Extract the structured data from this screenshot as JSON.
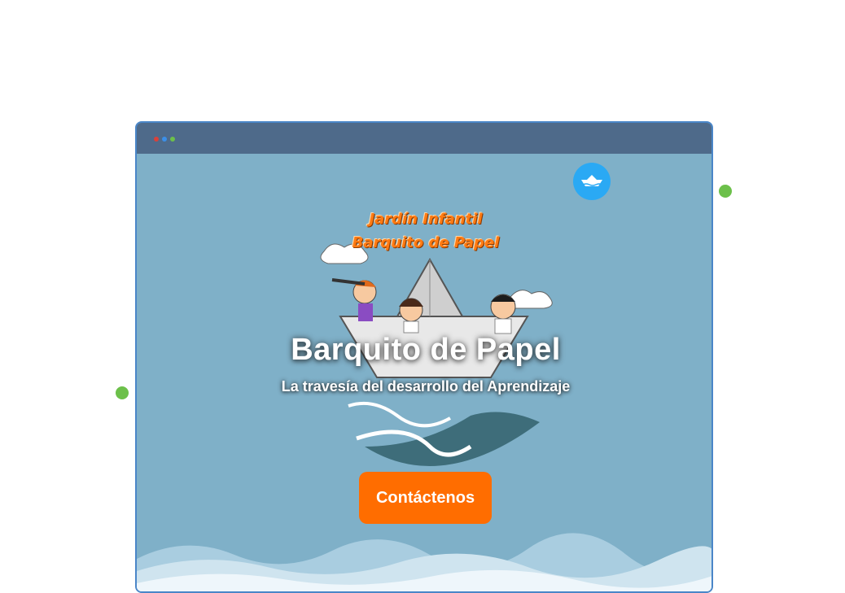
{
  "colors": {
    "page_background": "#ffffff",
    "window_border": "#4a86c8",
    "title_bar": "#4e6a8a",
    "hero_background": "#7fb0c8",
    "accent_orange": "#ff6d00",
    "badge_blue": "#2aa9f4",
    "decor_green": "#6cc04a",
    "window_dots": [
      "#d9413a",
      "#3b8fe8",
      "#6cc04a"
    ]
  },
  "window": {
    "controls": [
      "red-dot",
      "blue-dot",
      "green-dot"
    ]
  },
  "header": {
    "badge_icon": "paper-boat-icon"
  },
  "hero": {
    "logo_line_1": "Jardín Infantil",
    "logo_line_2": "Barquito de Papel",
    "title": "Barquito de Papel",
    "subtitle": "La travesía del desarrollo del Aprendizaje",
    "cta_label": "Contáctenos",
    "illustration_icon": "paper-boat-children-illustration"
  }
}
